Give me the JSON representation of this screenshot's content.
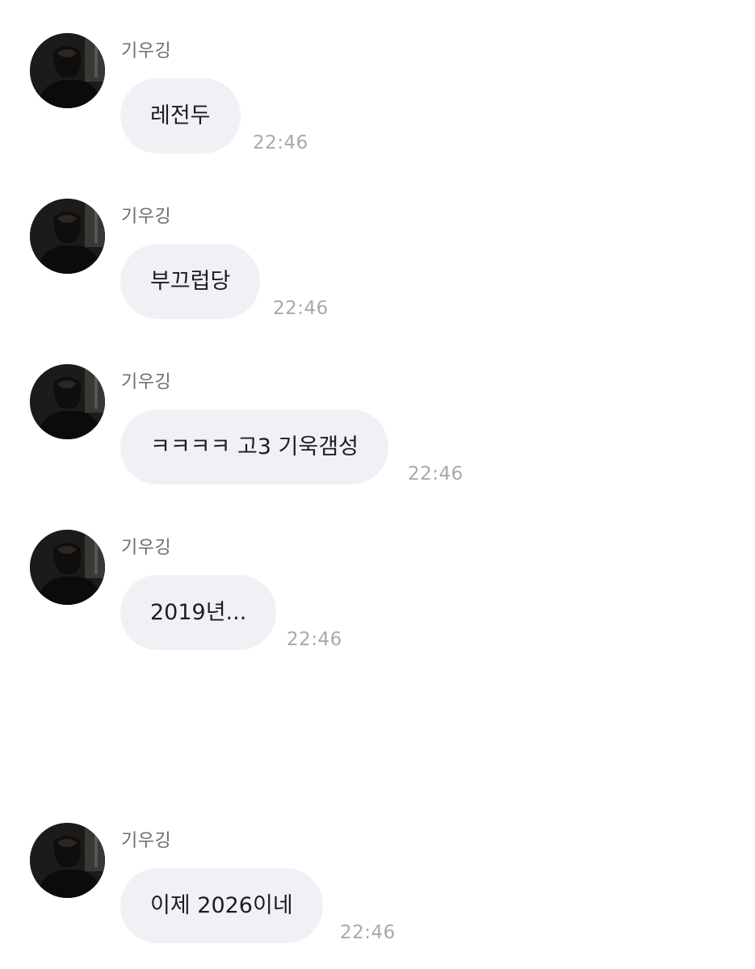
{
  "chat": {
    "messages": [
      {
        "sender": "기우깅",
        "text": "레전두",
        "time": "22:46",
        "avatar_icon": "profile-photo"
      },
      {
        "sender": "기우깅",
        "text": "부끄럽당",
        "time": "22:46",
        "avatar_icon": "profile-photo"
      },
      {
        "sender": "기우깅",
        "text": "ㅋㅋㅋㅋ 고3 기욱갬성",
        "time": "22:46",
        "avatar_icon": "profile-photo"
      },
      {
        "sender": "기우깅",
        "text": "2019년...",
        "time": "22:46",
        "avatar_icon": "profile-photo"
      },
      {
        "sender": "기우깅",
        "text": "이제 2026이네",
        "time": "22:46",
        "avatar_icon": "profile-photo"
      }
    ]
  },
  "colors": {
    "background": "#ffffff",
    "bubble": "#f1f1f5",
    "message_text": "#1d1d1f",
    "sender_text": "#6d6d6d",
    "time_text": "#a9a9ab"
  }
}
